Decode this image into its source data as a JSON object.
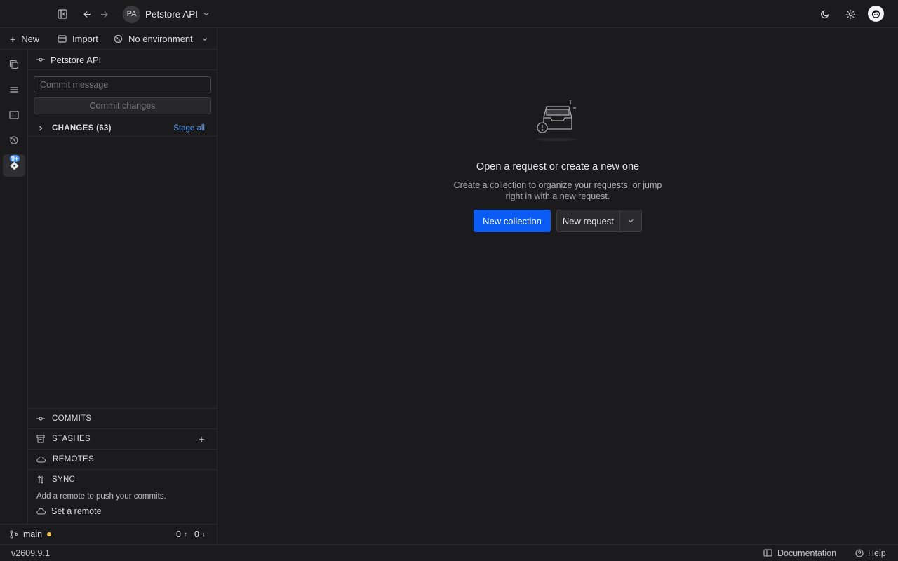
{
  "workspace": {
    "initials": "PA",
    "name": "Petstore API"
  },
  "toolbar": {
    "new_label": "New",
    "import_label": "Import",
    "environment": "No environment"
  },
  "panel": {
    "title": "Petstore API",
    "commit_placeholder": "Commit message",
    "commit_button": "Commit changes",
    "changes_label": "CHANGES (63)",
    "stage_all": "Stage all",
    "sections": {
      "commits": "COMMITS",
      "stashes": "STASHES",
      "remotes": "REMOTES",
      "sync": "SYNC"
    },
    "sync_hint": "Add a remote to push your commits.",
    "set_remote": "Set a remote"
  },
  "rail": {
    "badge": "9+"
  },
  "branch": {
    "name": "main",
    "ahead": "0",
    "behind": "0"
  },
  "empty_state": {
    "title": "Open a request or create a new one",
    "subtitle": "Create a collection to organize your requests, or jump right in with a new request.",
    "new_collection": "New collection",
    "new_request": "New request"
  },
  "status_bar": {
    "version": "v2609.9.1",
    "documentation": "Documentation",
    "help": "Help"
  },
  "colors": {
    "accent": "#0b5cf5",
    "link": "#5b9df5",
    "dirty_dot": "#f2c94c",
    "background": "#1b1b1d"
  }
}
